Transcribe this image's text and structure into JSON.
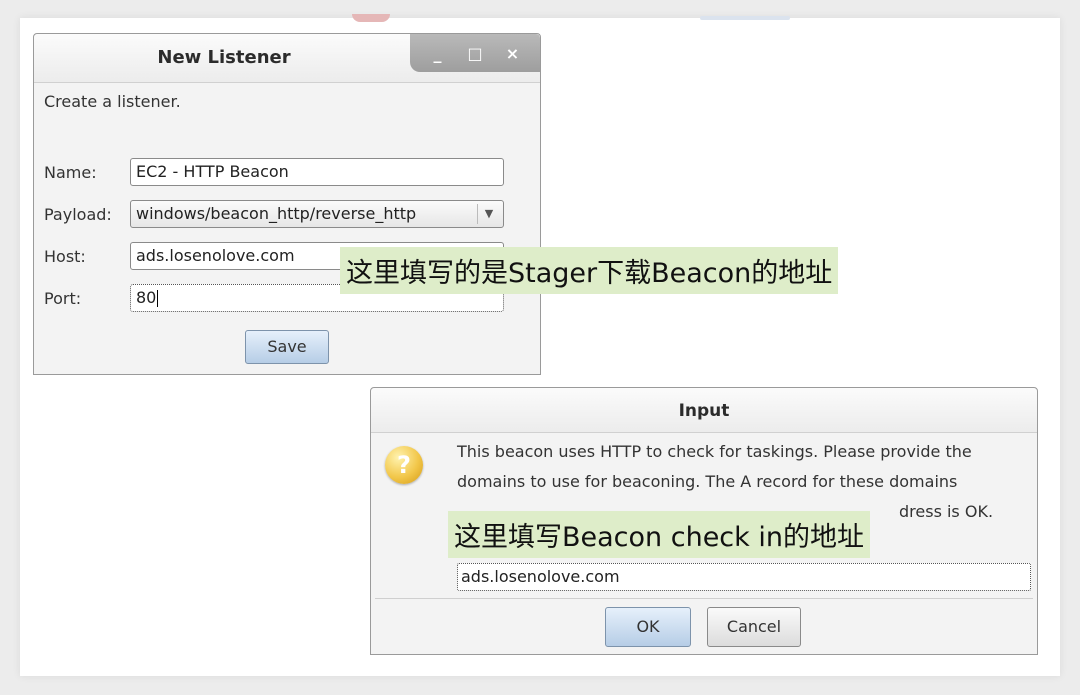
{
  "new_listener": {
    "title": "New Listener",
    "controls": {
      "minimize": "_",
      "maximize": "□",
      "close": "×"
    },
    "subtitle": "Create a listener.",
    "name_label": "Name:",
    "name_value": "EC2 - HTTP Beacon",
    "payload_label": "Payload:",
    "payload_value": "windows/beacon_http/reverse_http",
    "host_label": "Host:",
    "host_value": "ads.losenolove.com",
    "port_label": "Port:",
    "port_value": "80",
    "save_label": "Save"
  },
  "input_dialog": {
    "title": "Input",
    "icon": "question-icon",
    "message_lines": [
      "This beacon uses HTTP to check for taskings. Please provide the",
      "domains to use for beaconing. The A record for these domains",
      "dress is OK."
    ],
    "domain_value": "ads.losenolove.com",
    "ok_label": "OK",
    "cancel_label": "Cancel"
  },
  "annotations": {
    "stager_note": "这里填写的是Stager下载Beacon的地址",
    "checkin_note": "这里填写Beacon check in的地址",
    "highlight_color": "#deedc9"
  }
}
